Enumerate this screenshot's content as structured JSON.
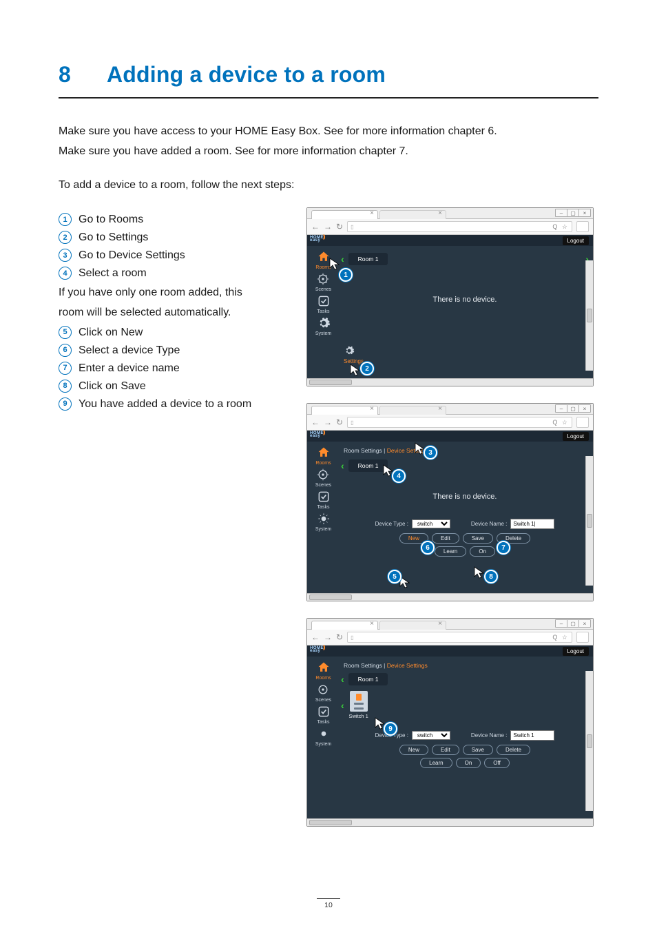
{
  "chapter": {
    "number": "8",
    "title": "Adding a device to a room"
  },
  "intro": {
    "line1": "Make sure you have access to your HOME Easy Box. See for more information chapter 6.",
    "line2": "Make sure you have added a room. See for more information chapter 7.",
    "lead": "To add a device to a room, follow the next steps:"
  },
  "steps": {
    "s1": "Go to Rooms",
    "s2": "Go to Settings",
    "s3": "Go to Device Settings",
    "s4": "Select a room",
    "note1": "If you have only one room added, this",
    "note2": "room will be selected automatically.",
    "s5": "Click on New",
    "s6": "Select a device Type",
    "s7": "Enter a device name",
    "s8": "Click on Save",
    "s9": "You have added a device to a room"
  },
  "ui": {
    "logout": "Logout",
    "logo_top": "HOME",
    "logo_bot": "easy",
    "sidebar": {
      "rooms": "Rooms",
      "scenes": "Scenes",
      "tasks": "Tasks",
      "system": "System"
    },
    "room_chip": "Room 1",
    "no_device": "There is no device.",
    "settings_label": "Settings",
    "crumbs_room": "Room Settings",
    "crumbs_sep": "   |   ",
    "crumbs_dev": "Device Settings",
    "form": {
      "type_label": "Device Type :",
      "type_value": "switch",
      "name_label": "Device Name :",
      "name_value_blank": "Switch 1|",
      "name_value": "Switch 1"
    },
    "buttons": {
      "new": "New",
      "edit": "Edit",
      "save": "Save",
      "delete": "Delete",
      "learn": "Learn",
      "on": "On",
      "off": "Off"
    },
    "device1_label": "Switch 1"
  },
  "callouts": {
    "c1": "1",
    "c2": "2",
    "c3": "3",
    "c4": "4",
    "c5": "5",
    "c6": "6",
    "c7": "7",
    "c8": "8",
    "c9": "9"
  },
  "page_number": "10"
}
